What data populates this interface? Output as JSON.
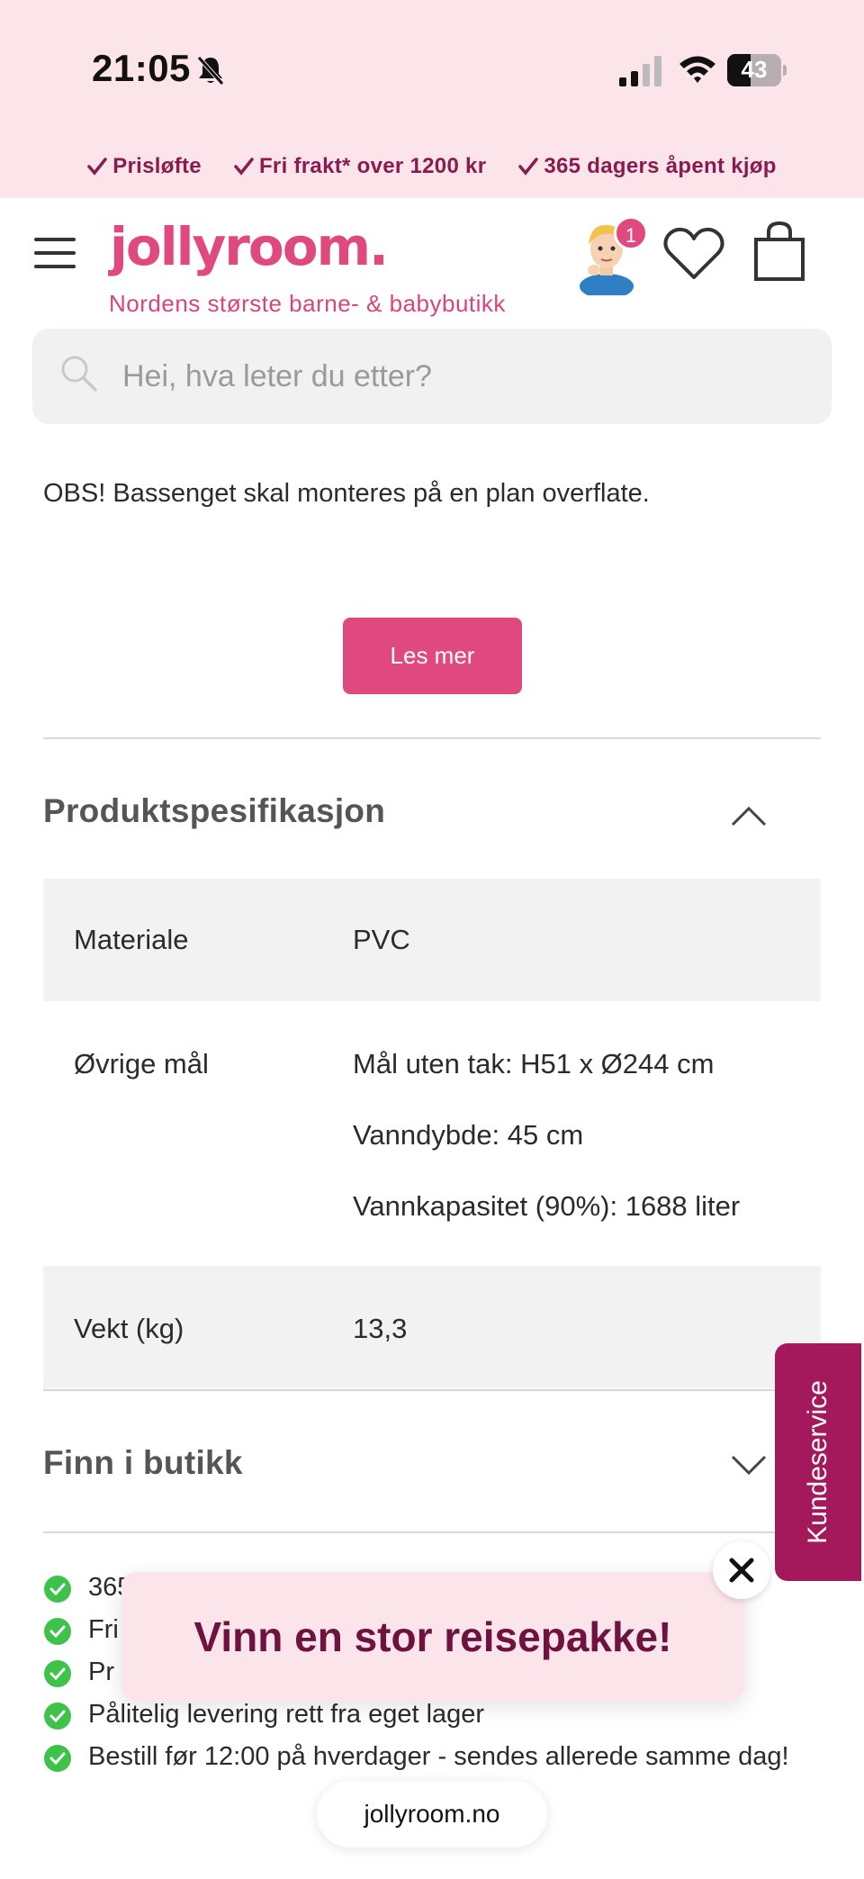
{
  "status_bar": {
    "time": "21:05",
    "battery": "43"
  },
  "usp": [
    {
      "label": "Prisløfte"
    },
    {
      "label": "Fri frakt* over 1200 kr"
    },
    {
      "label": "365 dagers åpent kjøp"
    }
  ],
  "header": {
    "logo": "jollyroom.",
    "tagline": "Nordens største barne- & babybutikk",
    "notification_count": "1"
  },
  "search": {
    "placeholder": "Hei, hva leter du etter?"
  },
  "description": {
    "obs_text": "OBS! Bassenget skal monteres på en plan overflate.",
    "read_more_label": "Les mer"
  },
  "spec_section": {
    "title": "Produktspesifikasjon",
    "rows": [
      {
        "label": "Materiale",
        "values": [
          "PVC"
        ]
      },
      {
        "label": "Øvrige mål",
        "values": [
          "Mål uten tak: H51 x Ø244 cm",
          "Vanndybde: 45 cm",
          "Vannkapasitet (90%): 1688 liter"
        ]
      },
      {
        "label": "Vekt (kg)",
        "values": [
          "13,3"
        ]
      }
    ]
  },
  "store_section": {
    "title": "Finn i butikk"
  },
  "benefits": [
    "365",
    "Fri",
    "Pr",
    "Pålitelig levering rett fra eget lager",
    "Bestill før 12:00 på hverdager - sendes allerede samme dag!"
  ],
  "customer_service": {
    "label": "Kundeservice"
  },
  "popup": {
    "text": "Vinn en stor reisepakke!"
  },
  "browser": {
    "url": "jollyroom.no"
  },
  "colors": {
    "brand_pink": "#e0497e",
    "light_pink": "#fbe4ea",
    "dark_magenta": "#a3195b",
    "check_green": "#3ec24a"
  }
}
